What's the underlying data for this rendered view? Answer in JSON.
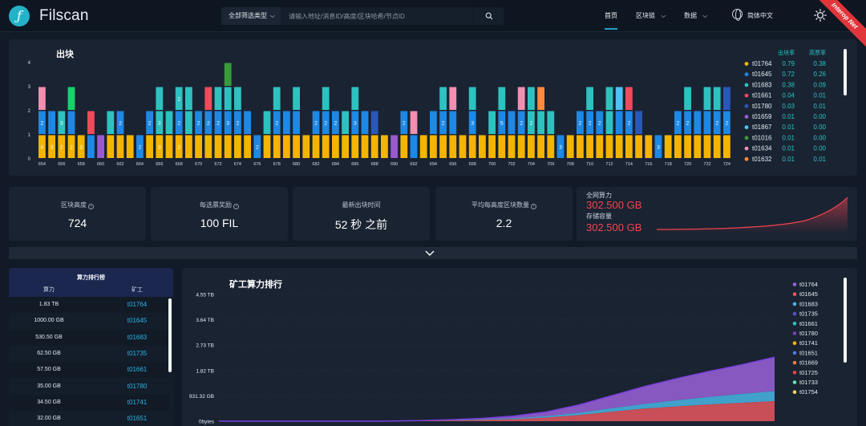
{
  "nav": {
    "logo": "Filscan",
    "filter_label": "全部筛选类型",
    "search_placeholder": "请输入地址/消息ID/高度/区块哈希/节点ID",
    "items": [
      "首页",
      "区块链",
      "数据"
    ],
    "language": "简体中文",
    "network_ribbon": "Interop Net"
  },
  "blocks": {
    "title": "出块",
    "y_ticks": [
      "4",
      "3",
      "2",
      "1",
      "0"
    ],
    "legend_headers": [
      "出块率",
      "高票率"
    ],
    "legend": [
      {
        "id": "t01764",
        "rate": "0.79",
        "win": "0.38",
        "color": "#f5b400"
      },
      {
        "id": "t01645",
        "rate": "0.72",
        "win": "0.26",
        "color": "#1e88e5"
      },
      {
        "id": "t01683",
        "rate": "0.38",
        "win": "0.09",
        "color": "#2dc2bf"
      },
      {
        "id": "t01661",
        "rate": "0.04",
        "win": "0.01",
        "color": "#ef4b5a"
      },
      {
        "id": "t01780",
        "rate": "0.03",
        "win": "0.01",
        "color": "#2a58b8"
      },
      {
        "id": "t01659",
        "rate": "0.01",
        "win": "0.00",
        "color": "#9b59d0"
      },
      {
        "id": "t01867",
        "rate": "0.01",
        "win": "0.00",
        "color": "#4fc3f7"
      },
      {
        "id": "t01016",
        "rate": "0.01",
        "win": "0.00",
        "color": "#3a9b3a"
      },
      {
        "id": "t01634",
        "rate": "0.01",
        "win": "0.00",
        "color": "#f48fb1"
      },
      {
        "id": "t01632",
        "rate": "0.01",
        "win": "0.01",
        "color": "#ff8a3d"
      }
    ]
  },
  "chart_data": [
    {
      "type": "bar",
      "title": "出块",
      "ylim": [
        0,
        4
      ],
      "categories": [
        "654",
        "655",
        "656",
        "657",
        "658",
        "659",
        "660",
        "661",
        "662",
        "663",
        "664",
        "665",
        "666",
        "667",
        "668",
        "669",
        "670",
        "671",
        "672",
        "673",
        "674",
        "675",
        "676",
        "677",
        "678",
        "679",
        "680",
        "681",
        "682",
        "683",
        "684",
        "685",
        "686",
        "687",
        "688",
        "689",
        "690",
        "691",
        "692",
        "693",
        "694",
        "695",
        "696",
        "697",
        "698",
        "699",
        "700",
        "701",
        "702",
        "703",
        "704",
        "705",
        "706",
        "707",
        "708",
        "709",
        "710",
        "711",
        "712",
        "713",
        "714",
        "715",
        "716",
        "717",
        "718",
        "719",
        "720",
        "721",
        "722",
        "723",
        "724"
      ],
      "tick_labels": [
        "654",
        "656",
        "658",
        "660",
        "662",
        "664",
        "666",
        "668",
        "670",
        "672",
        "674",
        "676",
        "678",
        "680",
        "682",
        "684",
        "686",
        "688",
        "690",
        "692",
        "694",
        "696",
        "698",
        "700",
        "702",
        "704",
        "706",
        "708",
        "710",
        "712",
        "714",
        "716",
        "718",
        "720",
        "722",
        "724"
      ],
      "stacks": [
        [
          {
            "m": "t01764",
            "v": 1,
            "n": "4"
          },
          {
            "m": "t01645",
            "v": 1,
            "n": "2"
          },
          {
            "m": "t01634",
            "v": 1
          }
        ],
        [
          {
            "m": "t01764",
            "v": 1,
            "n": "3"
          },
          {
            "m": "t01645",
            "v": 1
          }
        ],
        [
          {
            "m": "t01764",
            "v": 1,
            "n": "2"
          },
          {
            "m": "t01683",
            "v": 1,
            "n": "3"
          }
        ],
        [
          {
            "m": "t01764",
            "v": 1,
            "n": "2"
          },
          {
            "m": "t01645",
            "v": 1
          },
          {
            "m": "t01610",
            "v": 1
          }
        ],
        [
          {
            "m": "t01764",
            "v": 1,
            "n": "3"
          }
        ],
        [
          {
            "m": "t01645",
            "v": 1
          },
          {
            "m": "t01661",
            "v": 1
          }
        ],
        [
          {
            "m": "t01659",
            "v": 1
          }
        ],
        [
          {
            "m": "t01764",
            "v": 1
          },
          {
            "m": "t01683",
            "v": 1
          }
        ],
        [
          {
            "m": "t01764",
            "v": 1
          },
          {
            "m": "t01645",
            "v": 1,
            "n": "2"
          }
        ],
        [
          {
            "m": "t01764",
            "v": 1
          }
        ],
        [
          {
            "m": "t01645",
            "v": 1,
            "n": "2"
          }
        ],
        [
          {
            "m": "t01764",
            "v": 1
          },
          {
            "m": "t01645",
            "v": 1,
            "n": "2"
          }
        ],
        [
          {
            "m": "t01764",
            "v": 1,
            "n": "3"
          },
          {
            "m": "t01683",
            "v": 1,
            "n": "3"
          },
          {
            "m": "t01683",
            "v": 1
          }
        ],
        [
          {
            "m": "t01764",
            "v": 1
          },
          {
            "m": "t01683",
            "v": 1
          }
        ],
        [
          {
            "m": "t01764",
            "v": 1,
            "n": "2"
          },
          {
            "m": "t01645",
            "v": 1,
            "n": "2"
          },
          {
            "m": "t01683",
            "v": 1,
            "n": "2"
          }
        ],
        [
          {
            "m": "t01764",
            "v": 1
          },
          {
            "m": "t01683",
            "v": 1
          },
          {
            "m": "t01683",
            "v": 1
          }
        ],
        [
          {
            "m": "t01764",
            "v": 1
          },
          {
            "m": "t01645",
            "v": 1,
            "n": "2"
          }
        ],
        [
          {
            "m": "t01764",
            "v": 1
          },
          {
            "m": "t01645",
            "v": 1,
            "n": "2"
          },
          {
            "m": "t01661",
            "v": 1
          }
        ],
        [
          {
            "m": "t01764",
            "v": 1
          },
          {
            "m": "t01645",
            "v": 1,
            "n": "2"
          },
          {
            "m": "t01683",
            "v": 1
          }
        ],
        [
          {
            "m": "t01764",
            "v": 1
          },
          {
            "m": "t01645",
            "v": 1,
            "n": "3"
          },
          {
            "m": "t01683",
            "v": 1
          },
          {
            "m": "t01016",
            "v": 1
          }
        ],
        [
          {
            "m": "t01764",
            "v": 1
          },
          {
            "m": "t01645",
            "v": 1,
            "n": "2"
          },
          {
            "m": "t01683",
            "v": 1
          }
        ],
        [
          {
            "m": "t01764",
            "v": 1
          },
          {
            "m": "t01645",
            "v": 1
          }
        ],
        [
          {
            "m": "t01645",
            "v": 1,
            "n": "2"
          }
        ],
        [
          {
            "m": "t01764",
            "v": 1
          },
          {
            "m": "t01683",
            "v": 1
          }
        ],
        [
          {
            "m": "t01764",
            "v": 1
          },
          {
            "m": "t01645",
            "v": 1,
            "n": "2"
          },
          {
            "m": "t01683",
            "v": 1
          }
        ],
        [
          {
            "m": "t01764",
            "v": 1
          },
          {
            "m": "t01645",
            "v": 1
          }
        ],
        [
          {
            "m": "t01764",
            "v": 1
          },
          {
            "m": "t01645",
            "v": 1
          },
          {
            "m": "t01683",
            "v": 1
          }
        ],
        [
          {
            "m": "t01764",
            "v": 1
          }
        ],
        [
          {
            "m": "t01764",
            "v": 1
          },
          {
            "m": "t01645",
            "v": 1,
            "n": "2"
          }
        ],
        [
          {
            "m": "t01764",
            "v": 1
          },
          {
            "m": "t01645",
            "v": 1,
            "n": "2"
          },
          {
            "m": "t01683",
            "v": 1
          }
        ],
        [
          {
            "m": "t01764",
            "v": 1
          },
          {
            "m": "t01645",
            "v": 1,
            "n": "2"
          }
        ],
        [
          {
            "m": "t01764",
            "v": 1
          },
          {
            "m": "t01683",
            "v": 1
          }
        ],
        [
          {
            "m": "t01764",
            "v": 1
          },
          {
            "m": "t01645",
            "v": 1,
            "n": "3"
          },
          {
            "m": "t01683",
            "v": 1
          }
        ],
        [
          {
            "m": "t01764",
            "v": 1
          },
          {
            "m": "t01645",
            "v": 1
          }
        ],
        [
          {
            "m": "t01764",
            "v": 1
          },
          {
            "m": "t01780",
            "v": 1
          }
        ],
        [
          {
            "m": "t01764",
            "v": 1
          }
        ],
        [
          {
            "m": "t01659",
            "v": 1
          }
        ],
        [
          {
            "m": "t01764",
            "v": 1
          },
          {
            "m": "t01645",
            "v": 1,
            "n": "2"
          }
        ],
        [
          {
            "m": "t01645",
            "v": 1
          },
          {
            "m": "t01634",
            "v": 1
          }
        ],
        [
          {
            "m": "t01764",
            "v": 1
          }
        ],
        [
          {
            "m": "t01764",
            "v": 1
          },
          {
            "m": "t01645",
            "v": 1
          }
        ],
        [
          {
            "m": "t01764",
            "v": 1
          },
          {
            "m": "t01645",
            "v": 1,
            "n": "2"
          },
          {
            "m": "t01683",
            "v": 1
          }
        ],
        [
          {
            "m": "t01764",
            "v": 1
          },
          {
            "m": "t01645",
            "v": 1
          },
          {
            "m": "t01634",
            "v": 1
          }
        ],
        [
          {
            "m": "t01764",
            "v": 1
          }
        ],
        [
          {
            "m": "t01764",
            "v": 1
          },
          {
            "m": "t01645",
            "v": 1,
            "n": "3"
          },
          {
            "m": "t01683",
            "v": 1
          }
        ],
        [
          {
            "m": "t01764",
            "v": 1
          }
        ],
        [
          {
            "m": "t01764",
            "v": 1
          },
          {
            "m": "t01683",
            "v": 1
          }
        ],
        [
          {
            "m": "t01764",
            "v": 1
          },
          {
            "m": "t01645",
            "v": 1,
            "n": "5"
          },
          {
            "m": "t01683",
            "v": 1
          }
        ],
        [
          {
            "m": "t01764",
            "v": 1
          },
          {
            "m": "t01645",
            "v": 1
          }
        ],
        [
          {
            "m": "t01764",
            "v": 1
          },
          {
            "m": "t01645",
            "v": 1,
            "n": "2"
          },
          {
            "m": "t01634",
            "v": 1
          }
        ],
        [
          {
            "m": "t01764",
            "v": 1
          },
          {
            "m": "t01683",
            "v": 1,
            "n": "2"
          },
          {
            "m": "t01683",
            "v": 1
          }
        ],
        [
          {
            "m": "t01764",
            "v": 1
          },
          {
            "m": "t01683",
            "v": 1
          },
          {
            "m": "t01632",
            "v": 1
          }
        ],
        [
          {
            "m": "t01764",
            "v": 1
          },
          {
            "m": "t01683",
            "v": 1
          }
        ],
        [
          {
            "m": "t01645",
            "v": 1,
            "n": "3"
          }
        ],
        [
          {
            "m": "t01764",
            "v": 1
          }
        ],
        [
          {
            "m": "t01764",
            "v": 1
          },
          {
            "m": "t01645",
            "v": 1,
            "n": "2"
          }
        ],
        [
          {
            "m": "t01764",
            "v": 1
          },
          {
            "m": "t01645",
            "v": 1,
            "n": "2"
          },
          {
            "m": "t01683",
            "v": 1
          }
        ],
        [
          {
            "m": "t01764",
            "v": 1
          },
          {
            "m": "t01645",
            "v": 1,
            "n": "2"
          }
        ],
        [
          {
            "m": "t01764",
            "v": 1
          },
          {
            "m": "t01683",
            "v": 1
          },
          {
            "m": "t01683",
            "v": 1
          }
        ],
        [
          {
            "m": "t01764",
            "v": 1
          },
          {
            "m": "t01645",
            "v": 1
          },
          {
            "m": "t01867",
            "v": 1
          }
        ],
        [
          {
            "m": "t01764",
            "v": 1
          },
          {
            "m": "t01645",
            "v": 1,
            "n": "2"
          },
          {
            "m": "t01661",
            "v": 1
          }
        ],
        [
          {
            "m": "t01764",
            "v": 1
          },
          {
            "m": "t01780",
            "v": 1
          }
        ],
        [
          {
            "m": "t01764",
            "v": 1
          }
        ],
        [
          {
            "m": "t01645",
            "v": 1,
            "n": "3"
          }
        ],
        [
          {
            "m": "t01764",
            "v": 1
          }
        ],
        [
          {
            "m": "t01764",
            "v": 1
          },
          {
            "m": "t01645",
            "v": 1,
            "n": "2"
          }
        ],
        [
          {
            "m": "t01764",
            "v": 1
          },
          {
            "m": "t01645",
            "v": 1,
            "n": "2"
          },
          {
            "m": "t01683",
            "v": 1
          }
        ],
        [
          {
            "m": "t01764",
            "v": 1
          },
          {
            "m": "t01645",
            "v": 1
          }
        ],
        [
          {
            "m": "t01764",
            "v": 1
          },
          {
            "m": "t01645",
            "v": 1
          },
          {
            "m": "t01683",
            "v": 1
          }
        ],
        [
          {
            "m": "t01764",
            "v": 1
          },
          {
            "m": "t01645",
            "v": 1,
            "n": "2"
          },
          {
            "m": "t01683",
            "v": 1
          }
        ],
        [
          {
            "m": "t01764",
            "v": 1
          },
          {
            "m": "t01645",
            "v": 1,
            "n": "2"
          },
          {
            "m": "t01780",
            "v": 1
          }
        ]
      ]
    },
    {
      "type": "area",
      "title": "矿工算力排行",
      "y_ticks": [
        "4.55 TB",
        "3.64 TB",
        "2.73 TB",
        "1.82 TB",
        "931.32 GB",
        "0bytes"
      ],
      "series": [
        {
          "name": "t01764",
          "color": "#9b62d8",
          "values": [
            0,
            0,
            0,
            0,
            0,
            0,
            0.01,
            0.02,
            0.04,
            0.08,
            0.15,
            0.28,
            0.45,
            0.62,
            0.78,
            0.92,
            1.05,
            1.22
          ]
        },
        {
          "name": "t01645",
          "color": "#e8565e",
          "values": [
            0,
            0,
            0,
            0,
            0,
            0,
            0.01,
            0.02,
            0.04,
            0.07,
            0.13,
            0.22,
            0.34,
            0.45,
            0.53,
            0.6,
            0.66,
            0.72
          ]
        },
        {
          "name": "t01683",
          "color": "#48b7e6",
          "values": [
            0,
            0,
            0,
            0,
            0,
            0,
            0,
            0.01,
            0.02,
            0.03,
            0.05,
            0.08,
            0.12,
            0.17,
            0.22,
            0.27,
            0.32,
            0.36
          ]
        }
      ],
      "legend": [
        "t01764",
        "t01645",
        "t01683",
        "t01735",
        "t01661",
        "t01780",
        "t01741",
        "t01651",
        "t01669",
        "t01725",
        "t01733",
        "t01754"
      ],
      "legend_colors": [
        "#9b62d8",
        "#e8565e",
        "#48b7e6",
        "#5b4fd0",
        "#2dc2bf",
        "#7b3fb8",
        "#f5b400",
        "#4a7be8",
        "#ef7d3c",
        "#e84545",
        "#64e3b3",
        "#f2d35a"
      ]
    }
  ],
  "stats": [
    {
      "label": "区块高度",
      "value": "724"
    },
    {
      "label": "每选票奖励",
      "value": "100 FIL"
    },
    {
      "label": "最新出块时间",
      "value": "52 秒 之前"
    },
    {
      "label": "平均每高度区块数量",
      "value": "2.2"
    }
  ],
  "power": {
    "total_label": "全网算力",
    "total_value": "302.500 GB",
    "storage_label": "存储容量",
    "storage_value": "302.500 GB"
  },
  "ranking": {
    "title": "算力排行榜",
    "col_power": "算力",
    "col_miner": "矿工",
    "rows": [
      {
        "power": "1.83 TB",
        "miner": "t01764"
      },
      {
        "power": "1000.00 GB",
        "miner": "t01645"
      },
      {
        "power": "530.50 GB",
        "miner": "t01683"
      },
      {
        "power": "62.50 GB",
        "miner": "t01735"
      },
      {
        "power": "57.50 GB",
        "miner": "t01661"
      },
      {
        "power": "35.00 GB",
        "miner": "t01780"
      },
      {
        "power": "34.50 GB",
        "miner": "t01741"
      },
      {
        "power": "32.00 GB",
        "miner": "t01651"
      }
    ]
  },
  "miner_chart": {
    "title": "矿工算力排行"
  }
}
